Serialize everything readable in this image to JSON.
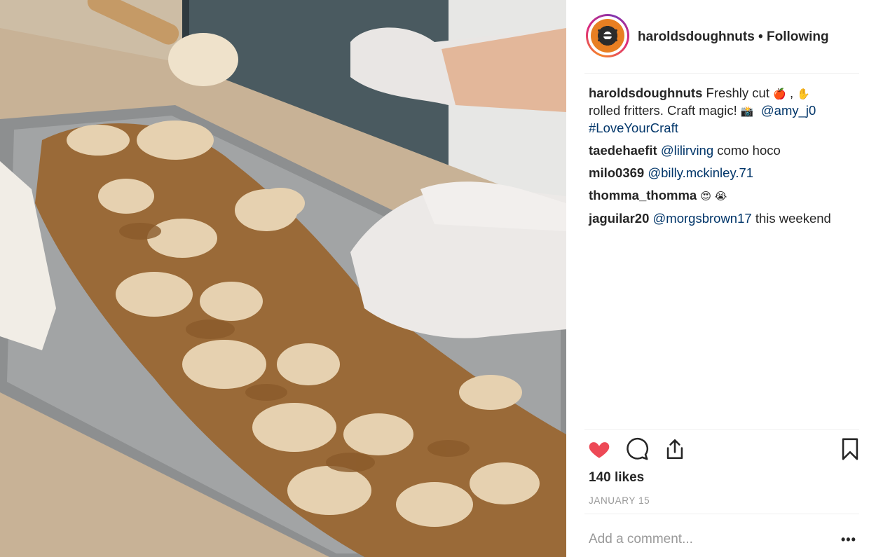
{
  "post": {
    "image_alt": "Gloved hands cutting apple fritter dough on a baking tray",
    "author": "haroldsdoughnuts",
    "separator": "•",
    "follow_status": "Following"
  },
  "caption": {
    "user": "haroldsdoughnuts",
    "text1": "Freshly cut",
    "emoji_apple": "🍎",
    "comma": ",",
    "emoji_hand": "✋",
    "text2": "rolled fritters. Craft magic!",
    "emoji_camera": "📸",
    "mention": "@amy_j0",
    "hashtag": "#LoveYourCraft"
  },
  "comments": [
    {
      "user": "taedehaefit",
      "mention": "@lilirving",
      "text": "como hoco"
    },
    {
      "user": "milo0369",
      "mention": "@billy.mckinley.71",
      "text": ""
    },
    {
      "user": "thomma_thomma",
      "mention": "",
      "text": "😍 😭"
    },
    {
      "user": "jaguilar20",
      "mention": "@morgsbrown17",
      "text": "this weekend"
    }
  ],
  "actions": {
    "like_icon": "heart-filled-icon",
    "comment_icon": "comment-bubble-icon",
    "share_icon": "share-upload-icon",
    "save_icon": "bookmark-icon"
  },
  "likes": "140 likes",
  "date": "JANUARY 15",
  "add_comment_placeholder": "Add a comment...",
  "more_label": "•••",
  "colors": {
    "heart": "#ed4956",
    "mention": "#003569",
    "muted": "#999999",
    "text": "#262626"
  }
}
